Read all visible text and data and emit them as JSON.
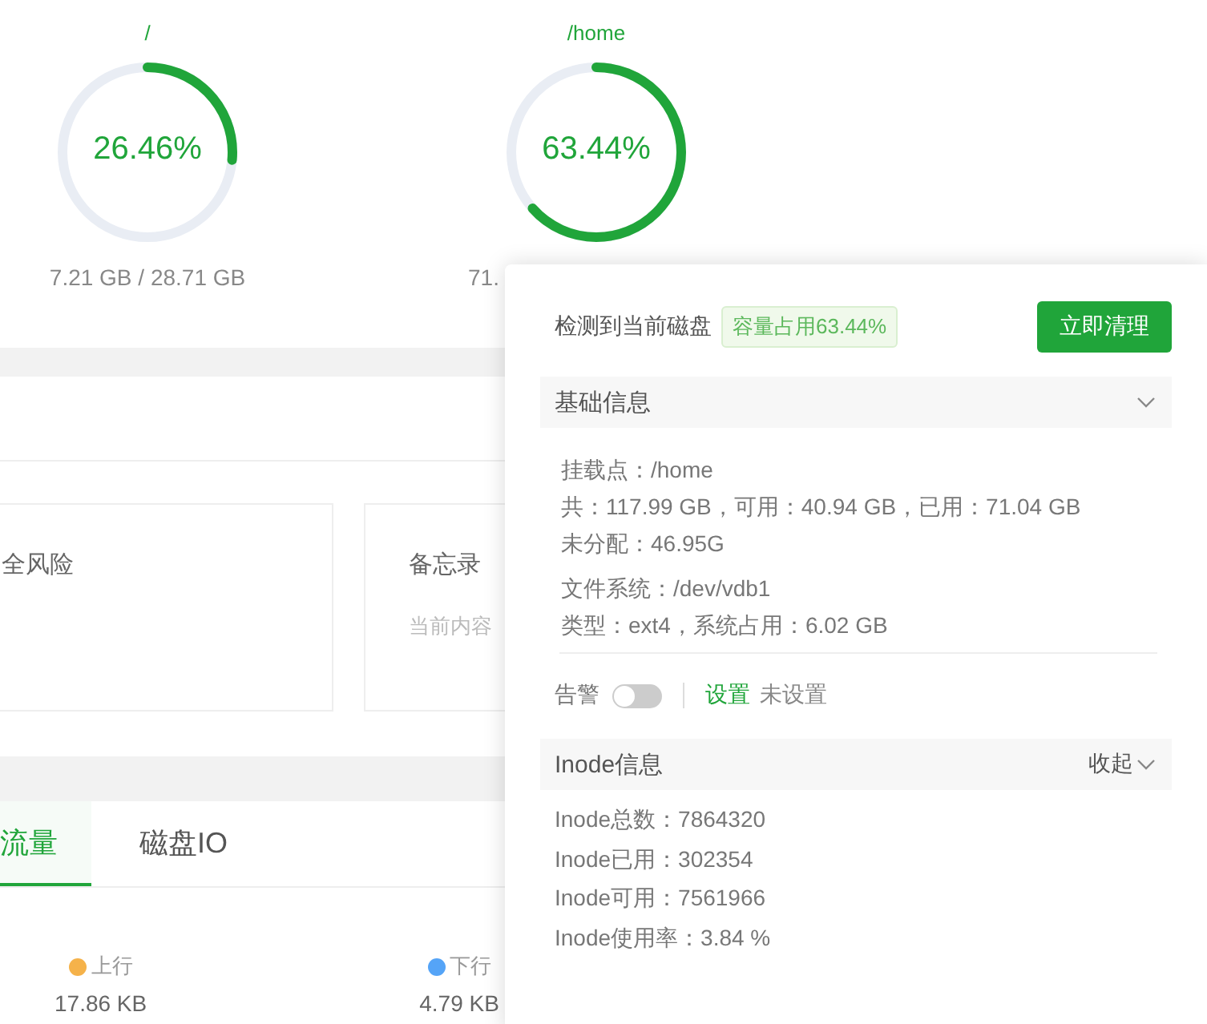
{
  "disk_gauges": [
    {
      "mount": "/",
      "level": 0.2646,
      "percent": "26.46%",
      "usage": "7.21 GB / 28.71 GB"
    },
    {
      "mount": "/home",
      "level": 0.6344,
      "percent": "63.44%",
      "usage": "71."
    }
  ],
  "cards": [
    {
      "title": "全风险"
    },
    {
      "title": "备忘录",
      "text": "当前内容"
    }
  ],
  "tabs": [
    {
      "label": "流量",
      "selected": true
    },
    {
      "label": "磁盘IO",
      "selected": false
    }
  ],
  "traffic": [
    {
      "label": "上行",
      "color": "#f5b24a",
      "value": "17.86 KB"
    },
    {
      "label": "下行",
      "color": "#55a4f7",
      "value": "4.79 KB"
    }
  ],
  "disk_panel": {
    "detected_label": "检测到当前磁盘",
    "usage_tag": "容量占用63.44%",
    "clean_button": "立即清理",
    "basic_info": {
      "title": "基础信息",
      "expanded": true,
      "groups": [
        [
          "挂载点：/home",
          "共：117.99 GB，可用：40.94 GB，已用：71.04 GB",
          "未分配：46.95G"
        ],
        [
          "文件系统：/dev/vdb1",
          "类型：ext4，系统占用：6.02 GB"
        ]
      ],
      "alert": {
        "label": "告警",
        "on": false,
        "link": "设置",
        "status": "未设置"
      }
    },
    "inode_info": {
      "title": "Inode信息",
      "toggle": "收起",
      "expanded": true,
      "lines": [
        "Inode总数：7864320",
        "Inode已用：302354",
        "Inode可用：7561966",
        "Inode使用率：3.84 %"
      ]
    }
  }
}
